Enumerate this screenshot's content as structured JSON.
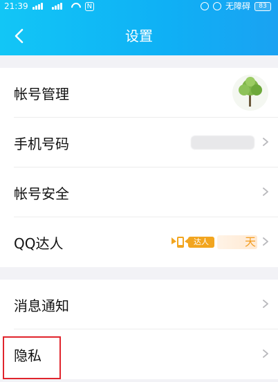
{
  "status_bar": {
    "time": "21:39",
    "accessibility_text": "无障碍",
    "battery": "83"
  },
  "header": {
    "title": "设置"
  },
  "section1": {
    "items": [
      {
        "label": "帐号管理"
      },
      {
        "label": "手机号码"
      },
      {
        "label": "帐号安全"
      },
      {
        "label": "QQ达人",
        "badge_text": "达人",
        "days_suffix": "天"
      }
    ]
  },
  "section2": {
    "items": [
      {
        "label": "消息通知"
      },
      {
        "label": "隐私"
      }
    ]
  },
  "colors": {
    "header_start": "#12c6f6",
    "header_end": "#1aa2f2",
    "highlight_red": "#e0242c",
    "badge_orange": "#f2a51f"
  },
  "icons": [
    "back-arrow-icon",
    "chevron-right-icon",
    "wifi-icon",
    "signal-icon",
    "battery-icon",
    "alarm-icon"
  ]
}
